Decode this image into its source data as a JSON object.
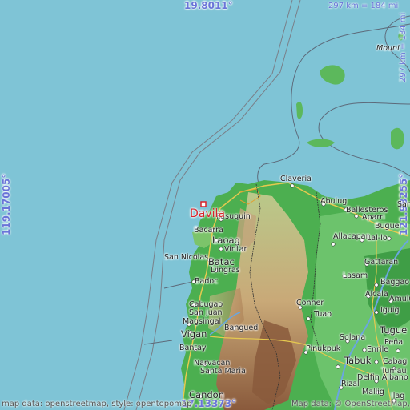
{
  "map": {
    "coords": {
      "top_lat": "19.8011°",
      "bottom_lat": "17.13373°",
      "left_lon": "119.17005°",
      "right_lon": "121.98255°"
    },
    "scale": {
      "horizontal": "297 km = 184 mi",
      "vertical": "297 km = 184 mi"
    },
    "highlight_place": "Davila",
    "places": [
      {
        "id": "claveria",
        "name": "Claveria"
      },
      {
        "id": "abulug",
        "name": "Abulug"
      },
      {
        "id": "ballesteros",
        "name": "Ballesteros"
      },
      {
        "id": "aparri",
        "name": "Aparri"
      },
      {
        "id": "pasuquin",
        "name": "Pasuquin"
      },
      {
        "id": "bacarra",
        "name": "Bacarra"
      },
      {
        "id": "laoag",
        "name": "Laoag"
      },
      {
        "id": "vintar",
        "name": "Vintar"
      },
      {
        "id": "sannicolas",
        "name": "San Nicolas"
      },
      {
        "id": "batac",
        "name": "Batac"
      },
      {
        "id": "dingras",
        "name": "Dingras"
      },
      {
        "id": "badoc",
        "name": "Badoc"
      },
      {
        "id": "cabugao",
        "name": "Cabugao"
      },
      {
        "id": "sanjuan",
        "name": "San Juan"
      },
      {
        "id": "magsingal",
        "name": "Magsingal"
      },
      {
        "id": "vigan",
        "name": "Vigan"
      },
      {
        "id": "bantay",
        "name": "Bantay"
      },
      {
        "id": "bangued",
        "name": "Bangued"
      },
      {
        "id": "narvacan",
        "name": "Narvacan"
      },
      {
        "id": "santamaria",
        "name": "Santa Maria"
      },
      {
        "id": "candon",
        "name": "Candon"
      },
      {
        "id": "allacapan",
        "name": "Allacapan"
      },
      {
        "id": "lallo",
        "name": "Lal-lo"
      },
      {
        "id": "buguey",
        "name": "Bugue"
      },
      {
        "id": "gattaran",
        "name": "Gattaran"
      },
      {
        "id": "lasam",
        "name": "Lasam"
      },
      {
        "id": "baggao",
        "name": "Baggao"
      },
      {
        "id": "alcala",
        "name": "Alcala"
      },
      {
        "id": "amulung",
        "name": "Amulung"
      },
      {
        "id": "iguig",
        "name": "Iguig"
      },
      {
        "id": "conner",
        "name": "Conner"
      },
      {
        "id": "tuao",
        "name": "Tuao"
      },
      {
        "id": "tuguegarao",
        "name": "Tugue"
      },
      {
        "id": "solana",
        "name": "Solana"
      },
      {
        "id": "enrile",
        "name": "Enrile"
      },
      {
        "id": "penablanca",
        "name": "Peña"
      },
      {
        "id": "pinukpuk",
        "name": "Pinukpuk"
      },
      {
        "id": "tabuk",
        "name": "Tabuk"
      },
      {
        "id": "cabagan",
        "name": "Cabag"
      },
      {
        "id": "tumauini",
        "name": "Tumau"
      },
      {
        "id": "delfinalbano",
        "name": "Delfin Albano"
      },
      {
        "id": "mallig",
        "name": "Mallig"
      },
      {
        "id": "ilagan",
        "name": "Ilag"
      },
      {
        "id": "rizal",
        "name": "Rizal"
      },
      {
        "id": "mount",
        "name": "Mount"
      },
      {
        "id": "santaana",
        "name": "Sant"
      }
    ],
    "attribution": "map data: openstreetmap, style: opentopomap",
    "attribution_right": "Map data: © OpenStreetMap, SRTM | Style: OpenTopoMap"
  },
  "colors": {
    "sea": "#7fc4d6",
    "lowland": "#4caf50",
    "highland": "#8d6e4a",
    "coord_text": "#6a75d8",
    "highlight": "#d9232a"
  }
}
